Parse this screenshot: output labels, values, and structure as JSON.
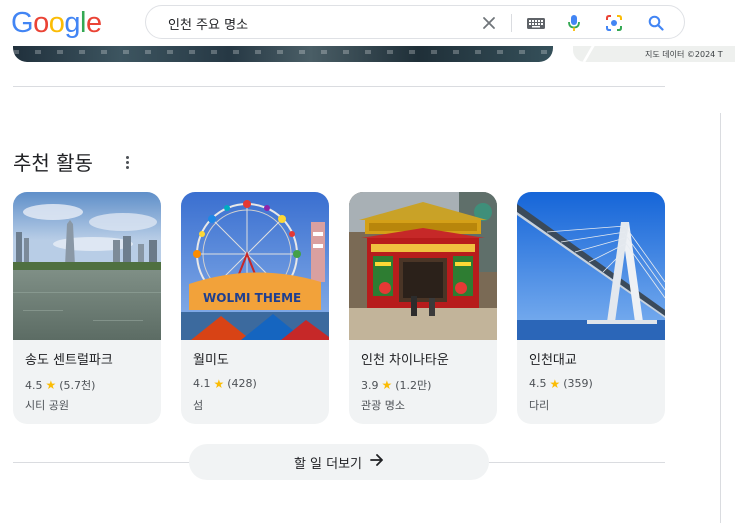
{
  "header": {
    "logo": [
      "G",
      "o",
      "o",
      "g",
      "l",
      "e"
    ],
    "logo_colors": [
      "#4285f4",
      "#ea4335",
      "#fbbc05",
      "#4285f4",
      "#34a853",
      "#ea4335"
    ],
    "search_value": "인천 주요 명소",
    "icons": [
      "close-icon",
      "keyboard-icon",
      "microphone-icon",
      "lens-icon",
      "search-icon"
    ]
  },
  "map": {
    "credit": "지도 데이터 ©2024 T"
  },
  "section": {
    "title": "추천 활동",
    "more_icon": "more-vert-icon"
  },
  "cards": [
    {
      "title": "송도 센트럴파크",
      "rating": "4.5",
      "reviews": "(5.7천)",
      "category": "시티 공원"
    },
    {
      "title": "월미도",
      "rating": "4.1",
      "reviews": "(428)",
      "category": "섬"
    },
    {
      "title": "인천 차이나타운",
      "rating": "3.9",
      "reviews": "(1.2만)",
      "category": "관광 명소"
    },
    {
      "title": "인천대교",
      "rating": "4.5",
      "reviews": "(359)",
      "category": "다리"
    }
  ],
  "more_button": {
    "label": "할 일 더보기",
    "icon": "arrow-right-icon"
  },
  "colors": {
    "star": "#fbbc04",
    "card_bg": "#f1f3f4"
  }
}
